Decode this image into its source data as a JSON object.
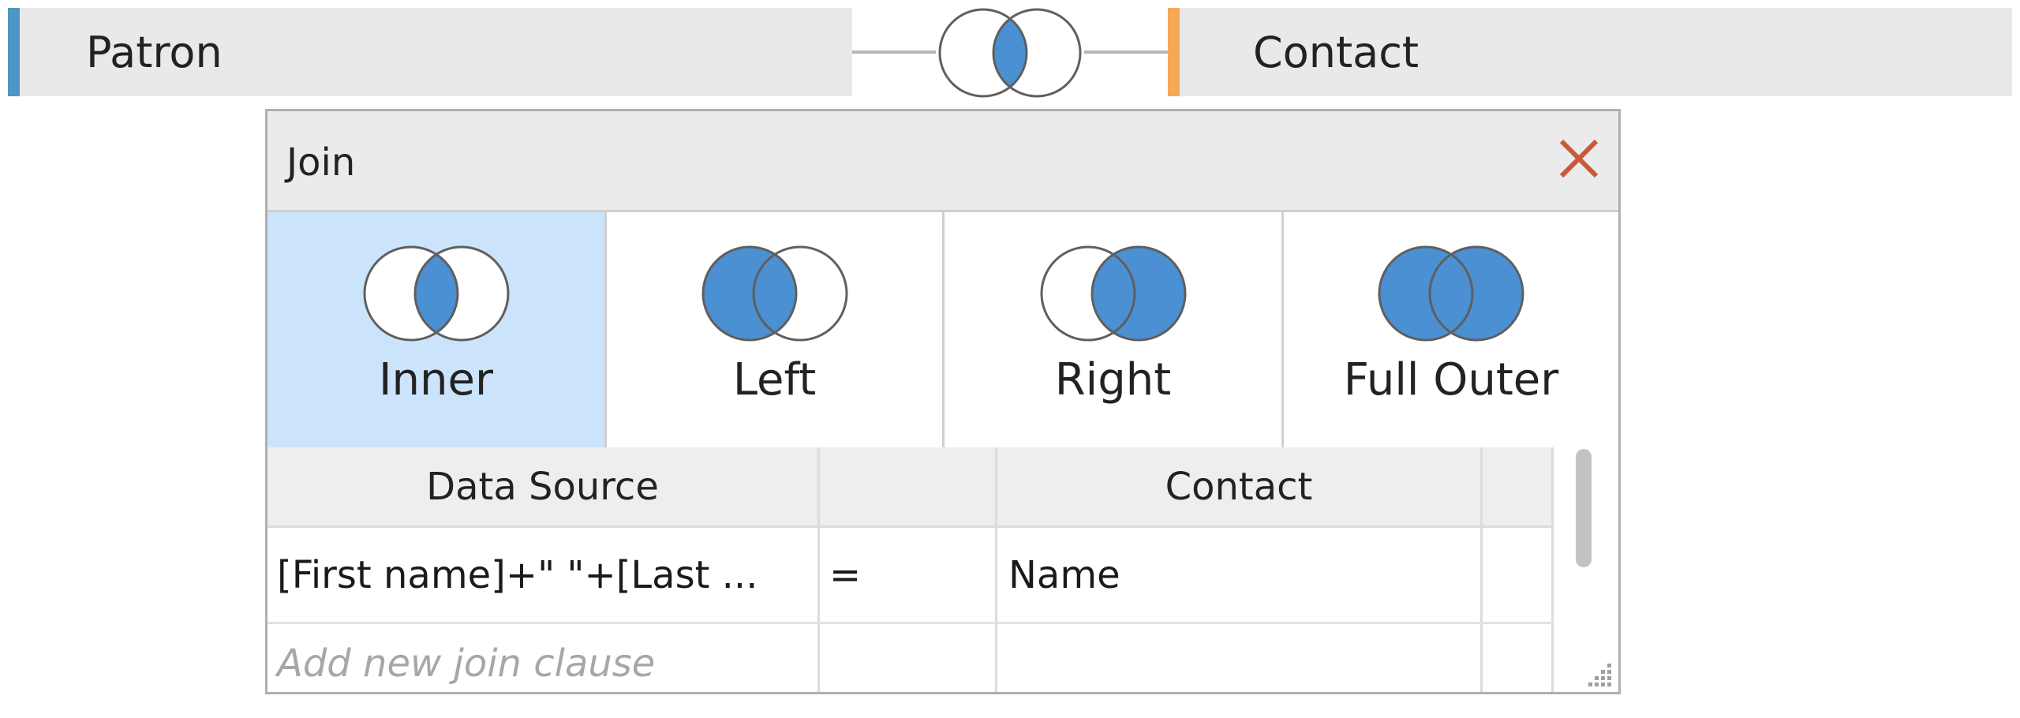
{
  "join_bar": {
    "left_table": "Patron",
    "right_table": "Contact",
    "left_accent": "#4e97c5",
    "right_accent": "#f7a856",
    "current_join_icon": "inner-join-icon"
  },
  "dialog": {
    "title": "Join",
    "close_icon": "close-icon",
    "join_types": [
      {
        "label": "Inner",
        "icon": "inner-join-icon",
        "selected": true
      },
      {
        "label": "Left",
        "icon": "left-join-icon",
        "selected": false
      },
      {
        "label": "Right",
        "icon": "right-join-icon",
        "selected": false
      },
      {
        "label": "Full Outer",
        "icon": "full-outer-join-icon",
        "selected": false
      }
    ],
    "grid": {
      "headers": [
        "Data Source",
        "",
        "Contact",
        ""
      ],
      "rows": [
        {
          "left": "[First name]+\" \"+[Last ...",
          "operator": "=",
          "right": "Name"
        }
      ],
      "add_clause_placeholder": "Add new join clause"
    }
  },
  "colors": {
    "venn_fill": "#4a90d2",
    "venn_stroke": "#5f5f5f",
    "selected_bg": "#cce4fb",
    "close_x": "#c85a3c"
  }
}
